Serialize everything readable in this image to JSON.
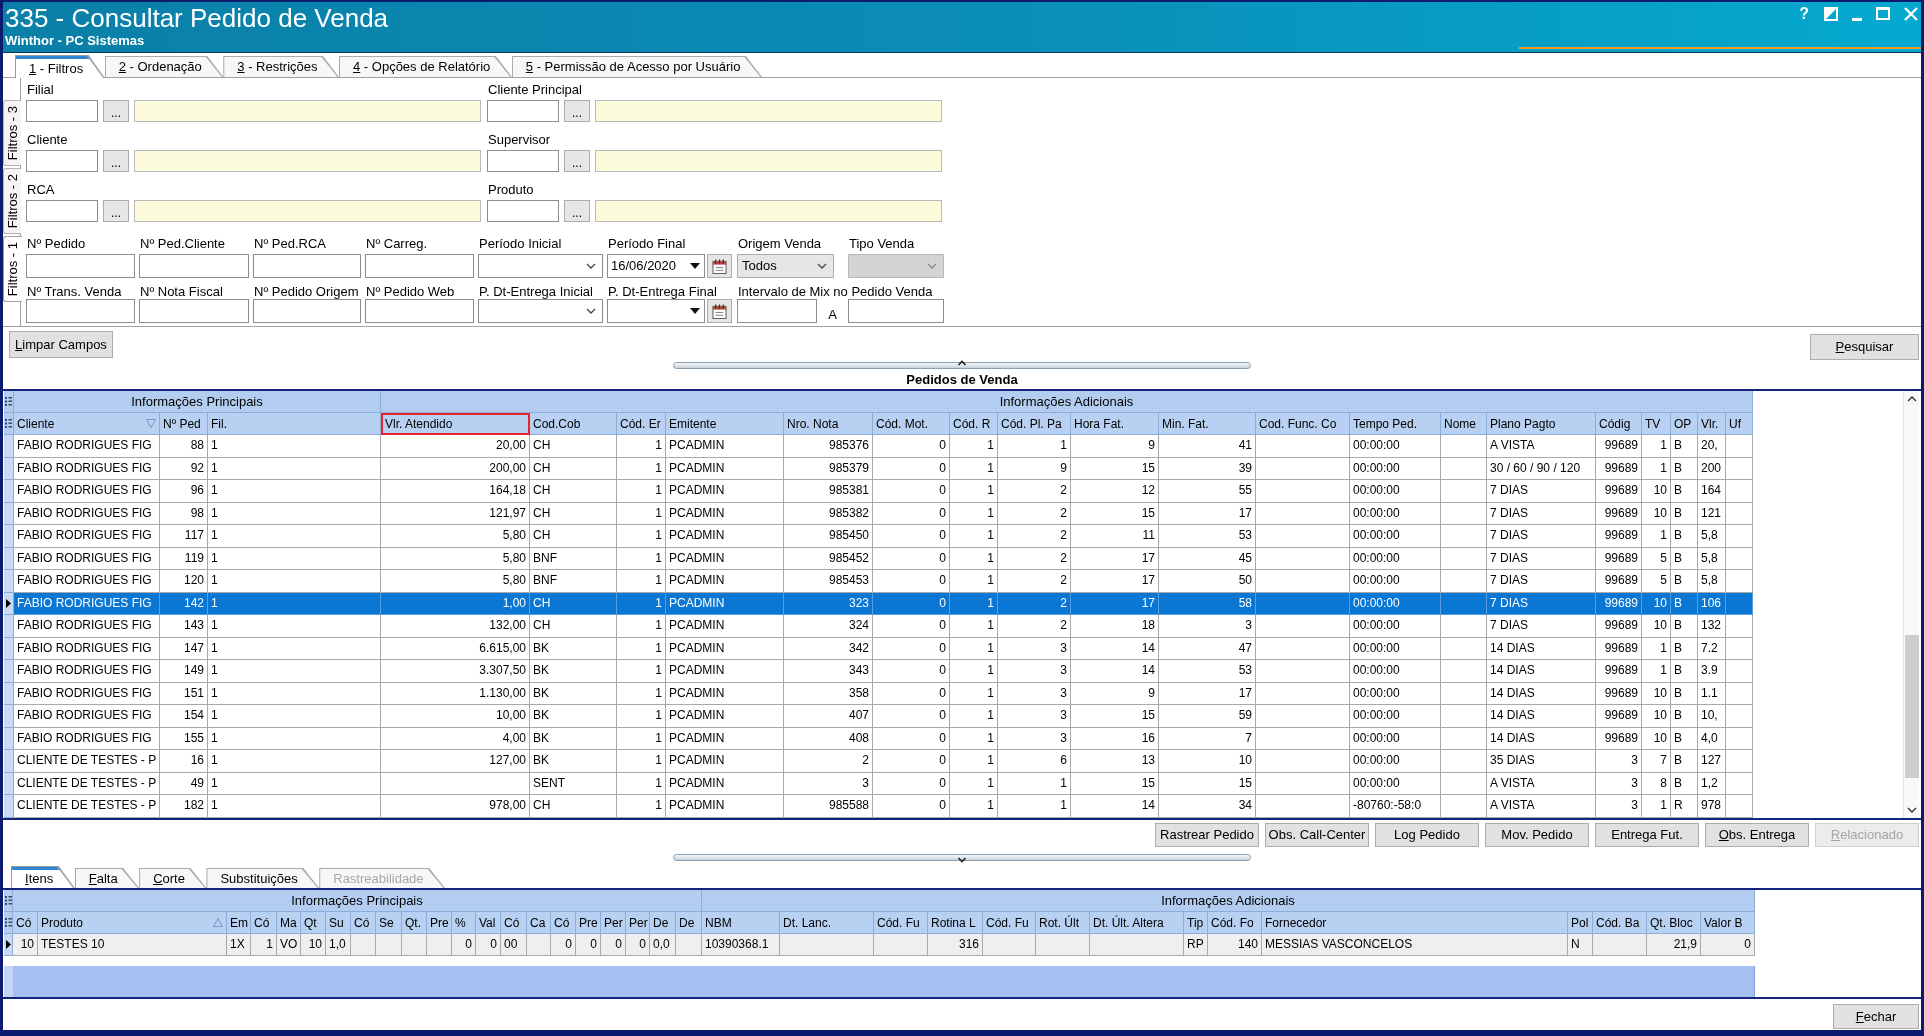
{
  "window": {
    "title": "335 - Consultar Pedido de Venda",
    "subtitle": "Winthor - PC Sistemas",
    "help": "?"
  },
  "tabs": [
    {
      "label": "1 - Filtros",
      "selected": true,
      "mnemonic": true
    },
    {
      "label": "2 - Ordenação",
      "selected": false,
      "mnemonic": true
    },
    {
      "label": "3 - Restrições",
      "selected": false,
      "mnemonic": true
    },
    {
      "label": "4 - Opções de Relatório",
      "selected": false,
      "mnemonic": true
    },
    {
      "label": "5 - Permissão de Acesso por Usuário",
      "selected": false,
      "mnemonic": true
    }
  ],
  "side_tabs": [
    {
      "label": "Filtros - 3",
      "selected": false
    },
    {
      "label": "Filtros - 2",
      "selected": false
    },
    {
      "label": "Filtros - 1",
      "selected": true
    }
  ],
  "lookups": [
    {
      "label": "Filial",
      "button": "..."
    },
    {
      "label": "Cliente Principal",
      "button": "..."
    },
    {
      "label": "Cliente",
      "button": "..."
    },
    {
      "label": "Supervisor",
      "button": "..."
    },
    {
      "label": "RCA",
      "button": "..."
    },
    {
      "label": "Produto",
      "button": "..."
    }
  ],
  "filter_rows": [
    {
      "fields": [
        {
          "label": "Nº Pedido",
          "kind": "text",
          "disabled": false
        },
        {
          "label": "Nº Ped.Cliente",
          "kind": "text",
          "disabled": false
        },
        {
          "label": "Nº Ped.RCA",
          "kind": "text",
          "disabled": false
        },
        {
          "label": "Nº Carreg.",
          "kind": "text",
          "disabled": false
        },
        {
          "label": "Período Inicial",
          "kind": "combo",
          "disabled": false
        },
        {
          "label": "Período Final",
          "kind": "date",
          "value": "16/06/2020",
          "disabled": false
        },
        {
          "label": "Origem Venda",
          "kind": "select",
          "value": "Todos",
          "disabled": false
        },
        {
          "label": "Tipo Venda",
          "kind": "select",
          "disabled": true
        }
      ]
    },
    {
      "fields": [
        {
          "label": "Nº Trans. Venda",
          "kind": "text",
          "disabled": false
        },
        {
          "label": "Nº Nota Fiscal",
          "kind": "text",
          "disabled": false
        },
        {
          "label": "Nº Pedido Origem",
          "kind": "text",
          "disabled": false
        },
        {
          "label": "Nº Pedido Web",
          "kind": "text",
          "disabled": false
        },
        {
          "label": "P. Dt-Entrega Inicial",
          "kind": "combo",
          "disabled": false
        },
        {
          "label": "P. Dt-Entrega Final",
          "kind": "date",
          "disabled": false
        },
        {
          "label": "Intervalo de Mix no Pedido Venda",
          "kind": "range",
          "separator": "A",
          "disabled": false
        }
      ]
    }
  ],
  "clear_button": {
    "label": "Limpar Campos",
    "mnemonic": true
  },
  "search_button": {
    "label": "Pesquisar",
    "mnemonic": true
  },
  "orders": {
    "title": "Pedidos de Venda",
    "groups": [
      {
        "label": "Informações Principais",
        "columns": [
          {
            "label": "Cliente",
            "kind": "text",
            "highlighted": false,
            "filter": true
          },
          {
            "label": "Nº Ped",
            "kind": "number",
            "highlighted": false,
            "filter": false
          },
          {
            "label": "Fil.",
            "kind": "text",
            "highlighted": false,
            "filter": false
          }
        ]
      },
      {
        "label": "Informações Adicionais",
        "columns": [
          {
            "label": "Vlr. Atendido",
            "kind": "number",
            "highlighted": true,
            "filter": false
          },
          {
            "label": "Cod.Cob",
            "kind": "text",
            "highlighted": false,
            "filter": false
          },
          {
            "label": "Cód. Er",
            "kind": "number",
            "highlighted": false,
            "filter": false
          },
          {
            "label": "Emitente",
            "kind": "text",
            "highlighted": false,
            "filter": false
          },
          {
            "label": "Nro. Nota",
            "kind": "number",
            "highlighted": false,
            "filter": false
          },
          {
            "label": "Cód. Mot.",
            "kind": "number",
            "highlighted": false,
            "filter": false
          },
          {
            "label": "Cód. R",
            "kind": "number",
            "highlighted": false,
            "filter": false
          },
          {
            "label": "Cód. Pl. Pa",
            "kind": "number",
            "highlighted": false,
            "filter": false
          },
          {
            "label": "Hora Fat.",
            "kind": "number",
            "highlighted": false,
            "filter": false
          },
          {
            "label": "Min. Fat.",
            "kind": "number",
            "highlighted": false,
            "filter": false
          },
          {
            "label": "Cod. Func. Co",
            "kind": "text",
            "highlighted": false,
            "filter": false
          },
          {
            "label": "Tempo Ped.",
            "kind": "text",
            "highlighted": false,
            "filter": false
          },
          {
            "label": "Nome",
            "kind": "text",
            "highlighted": false,
            "filter": false
          },
          {
            "label": "Plano Pagto",
            "kind": "text",
            "highlighted": false,
            "filter": false
          },
          {
            "label": "Códig",
            "kind": "number",
            "highlighted": false,
            "filter": false
          },
          {
            "label": "TV",
            "kind": "number",
            "highlighted": false,
            "filter": false
          },
          {
            "label": "OP",
            "kind": "text",
            "highlighted": false,
            "filter": false
          },
          {
            "label": "Vlr.",
            "kind": "text",
            "highlighted": false,
            "filter": false
          },
          {
            "label": "Uf",
            "kind": "text",
            "highlighted": false,
            "filter": false
          }
        ]
      }
    ],
    "rows": [
      {
        "selected": false,
        "cells": [
          "FABIO RODRIGUES FIG",
          "88",
          "1",
          "20,00",
          "CH",
          "1",
          "PCADMIN",
          "985376",
          "0",
          "1",
          "1",
          "9",
          "41",
          null,
          "00:00:00",
          null,
          "A VISTA",
          "99689",
          "1",
          "B",
          "20,",
          null
        ]
      },
      {
        "selected": false,
        "cells": [
          "FABIO RODRIGUES FIG",
          "92",
          "1",
          "200,00",
          "CH",
          "1",
          "PCADMIN",
          "985379",
          "0",
          "1",
          "9",
          "15",
          "39",
          null,
          "00:00:00",
          null,
          "30 / 60 / 90 / 120",
          "99689",
          "1",
          "B",
          "200",
          null
        ]
      },
      {
        "selected": false,
        "cells": [
          "FABIO RODRIGUES FIG",
          "96",
          "1",
          "164,18",
          "CH",
          "1",
          "PCADMIN",
          "985381",
          "0",
          "1",
          "2",
          "12",
          "55",
          null,
          "00:00:00",
          null,
          "7 DIAS",
          "99689",
          "10",
          "B",
          "164",
          null
        ]
      },
      {
        "selected": false,
        "cells": [
          "FABIO RODRIGUES FIG",
          "98",
          "1",
          "121,97",
          "CH",
          "1",
          "PCADMIN",
          "985382",
          "0",
          "1",
          "2",
          "15",
          "17",
          null,
          "00:00:00",
          null,
          "7 DIAS",
          "99689",
          "10",
          "B",
          "121",
          null
        ]
      },
      {
        "selected": false,
        "cells": [
          "FABIO RODRIGUES FIG",
          "117",
          "1",
          "5,80",
          "CH",
          "1",
          "PCADMIN",
          "985450",
          "0",
          "1",
          "2",
          "11",
          "53",
          null,
          "00:00:00",
          null,
          "7 DIAS",
          "99689",
          "1",
          "B",
          "5,8",
          null
        ]
      },
      {
        "selected": false,
        "cells": [
          "FABIO RODRIGUES FIG",
          "119",
          "1",
          "5,80",
          "BNF",
          "1",
          "PCADMIN",
          "985452",
          "0",
          "1",
          "2",
          "17",
          "45",
          null,
          "00:00:00",
          null,
          "7 DIAS",
          "99689",
          "5",
          "B",
          "5,8",
          null
        ]
      },
      {
        "selected": false,
        "cells": [
          "FABIO RODRIGUES FIG",
          "120",
          "1",
          "5,80",
          "BNF",
          "1",
          "PCADMIN",
          "985453",
          "0",
          "1",
          "2",
          "17",
          "50",
          null,
          "00:00:00",
          null,
          "7 DIAS",
          "99689",
          "5",
          "B",
          "5,8",
          null
        ]
      },
      {
        "selected": true,
        "cells": [
          "FABIO RODRIGUES FIG",
          "142",
          "1",
          "1,00",
          "CH",
          "1",
          "PCADMIN",
          "323",
          "0",
          "1",
          "2",
          "17",
          "58",
          null,
          "00:00:00",
          null,
          "7 DIAS",
          "99689",
          "10",
          "B",
          "106",
          null
        ]
      },
      {
        "selected": false,
        "cells": [
          "FABIO RODRIGUES FIG",
          "143",
          "1",
          "132,00",
          "CH",
          "1",
          "PCADMIN",
          "324",
          "0",
          "1",
          "2",
          "18",
          "3",
          null,
          "00:00:00",
          null,
          "7 DIAS",
          "99689",
          "10",
          "B",
          "132",
          null
        ]
      },
      {
        "selected": false,
        "cells": [
          "FABIO RODRIGUES FIG",
          "147",
          "1",
          "6.615,00",
          "BK",
          "1",
          "PCADMIN",
          "342",
          "0",
          "1",
          "3",
          "14",
          "47",
          null,
          "00:00:00",
          null,
          "14 DIAS",
          "99689",
          "1",
          "B",
          "7.2",
          null
        ]
      },
      {
        "selected": false,
        "cells": [
          "FABIO RODRIGUES FIG",
          "149",
          "1",
          "3.307,50",
          "BK",
          "1",
          "PCADMIN",
          "343",
          "0",
          "1",
          "3",
          "14",
          "53",
          null,
          "00:00:00",
          null,
          "14 DIAS",
          "99689",
          "1",
          "B",
          "3.9",
          null
        ]
      },
      {
        "selected": false,
        "cells": [
          "FABIO RODRIGUES FIG",
          "151",
          "1",
          "1.130,00",
          "BK",
          "1",
          "PCADMIN",
          "358",
          "0",
          "1",
          "3",
          "9",
          "17",
          null,
          "00:00:00",
          null,
          "14 DIAS",
          "99689",
          "10",
          "B",
          "1.1",
          null
        ]
      },
      {
        "selected": false,
        "cells": [
          "FABIO RODRIGUES FIG",
          "154",
          "1",
          "10,00",
          "BK",
          "1",
          "PCADMIN",
          "407",
          "0",
          "1",
          "3",
          "15",
          "59",
          null,
          "00:00:00",
          null,
          "14 DIAS",
          "99689",
          "10",
          "B",
          "10,",
          null
        ]
      },
      {
        "selected": false,
        "cells": [
          "FABIO RODRIGUES FIG",
          "155",
          "1",
          "4,00",
          "BK",
          "1",
          "PCADMIN",
          "408",
          "0",
          "1",
          "3",
          "16",
          "7",
          null,
          "00:00:00",
          null,
          "14 DIAS",
          "99689",
          "10",
          "B",
          "4,0",
          null
        ]
      },
      {
        "selected": false,
        "cells": [
          "CLIENTE DE TESTES - P",
          "16",
          "1",
          "127,00",
          "BK",
          "1",
          "PCADMIN",
          "2",
          "0",
          "1",
          "6",
          "13",
          "10",
          null,
          "00:00:00",
          null,
          "35 DIAS",
          "3",
          "7",
          "B",
          "127",
          null
        ]
      },
      {
        "selected": false,
        "cells": [
          "CLIENTE DE TESTES - P",
          "49",
          "1",
          null,
          "SENT",
          "1",
          "PCADMIN",
          "3",
          "0",
          "1",
          "1",
          "15",
          "15",
          null,
          "00:00:00",
          null,
          "A VISTA",
          "3",
          "8",
          "B",
          "1,2",
          null
        ]
      },
      {
        "selected": false,
        "cells": [
          "CLIENTE DE TESTES - P",
          "182",
          "1",
          "978,00",
          "CH",
          "1",
          "PCADMIN",
          "985588",
          "0",
          "1",
          "1",
          "14",
          "34",
          null,
          "-80760:-58:0",
          null,
          "A VISTA",
          "3",
          "1",
          "R",
          "978",
          null
        ]
      }
    ]
  },
  "order_buttons": [
    {
      "label": "Rastrear Pedido",
      "mnemonic": false,
      "disabled": false
    },
    {
      "label": "Obs. Call-Center",
      "mnemonic": false,
      "disabled": false
    },
    {
      "label": "Log Pedido",
      "mnemonic": false,
      "disabled": false
    },
    {
      "label": "Mov. Pedido",
      "mnemonic": false,
      "disabled": false
    },
    {
      "label": "Entrega Fut.",
      "mnemonic": false,
      "disabled": false
    },
    {
      "label": "Obs. Entrega",
      "mnemonic": true,
      "disabled": false
    },
    {
      "label": "Relacionado",
      "mnemonic": true,
      "disabled": true
    }
  ],
  "detail_tabs": [
    {
      "label": "Itens",
      "selected": true,
      "mnemonic": true,
      "disabled": false
    },
    {
      "label": "Falta",
      "selected": false,
      "mnemonic": true,
      "disabled": false
    },
    {
      "label": "Corte",
      "selected": false,
      "mnemonic": true,
      "disabled": false
    },
    {
      "label": "Substituições",
      "selected": false,
      "mnemonic": false,
      "disabled": false
    },
    {
      "label": "Rastreabilidade",
      "selected": false,
      "mnemonic": false,
      "disabled": true
    }
  ],
  "items": {
    "groups": [
      {
        "label": "Informações Principais",
        "columns": [
          {
            "label": "Có",
            "kind": "number",
            "sorted": false
          },
          {
            "label": "Produto",
            "kind": "text",
            "sorted": true
          },
          {
            "label": "Em",
            "kind": "text",
            "sorted": false
          },
          {
            "label": "Có",
            "kind": "number",
            "sorted": false
          },
          {
            "label": "Ma",
            "kind": "text",
            "sorted": false
          },
          {
            "label": "Qt",
            "kind": "number",
            "sorted": false
          },
          {
            "label": "Su",
            "kind": "text",
            "sorted": false
          },
          {
            "label": "Có",
            "kind": "text",
            "sorted": false
          },
          {
            "label": "Se",
            "kind": "text",
            "sorted": false
          },
          {
            "label": "Qt.",
            "kind": "text",
            "sorted": false
          },
          {
            "label": "Pre",
            "kind": "text",
            "sorted": false
          },
          {
            "label": "%",
            "kind": "number",
            "sorted": false
          },
          {
            "label": "Val",
            "kind": "number",
            "sorted": false
          },
          {
            "label": "Có",
            "kind": "text",
            "sorted": false
          },
          {
            "label": "Ca",
            "kind": "text",
            "sorted": false
          },
          {
            "label": "Có",
            "kind": "number",
            "sorted": false
          },
          {
            "label": "Pre",
            "kind": "number",
            "sorted": false
          },
          {
            "label": "Per",
            "kind": "number",
            "sorted": false
          },
          {
            "label": "Per",
            "kind": "number",
            "sorted": false
          },
          {
            "label": "De",
            "kind": "text",
            "sorted": false
          },
          {
            "label": "De",
            "kind": "text",
            "sorted": false
          }
        ]
      },
      {
        "label": "Informações Adicionais",
        "columns": [
          {
            "label": "NBM",
            "kind": "text",
            "sorted": false
          },
          {
            "label": "Dt. Lanc.",
            "kind": "text",
            "sorted": false
          },
          {
            "label": "Cód. Fu",
            "kind": "text",
            "sorted": false
          },
          {
            "label": "Rotina L",
            "kind": "number",
            "sorted": false
          },
          {
            "label": "Cód. Fu",
            "kind": "text",
            "sorted": false
          },
          {
            "label": "Rot. Últ",
            "kind": "text",
            "sorted": false
          },
          {
            "label": "Dt. Últ. Altera",
            "kind": "text",
            "sorted": false
          },
          {
            "label": "Tip",
            "kind": "text",
            "sorted": false
          },
          {
            "label": "Cód. Fo",
            "kind": "number",
            "sorted": false
          },
          {
            "label": "Fornecedor",
            "kind": "text",
            "sorted": false
          },
          {
            "label": "Pol",
            "kind": "text",
            "sorted": false
          },
          {
            "label": "Cód. Ba",
            "kind": "text",
            "sorted": false
          },
          {
            "label": "Qt. Bloc",
            "kind": "number",
            "sorted": false
          },
          {
            "label": "Valor B",
            "kind": "number",
            "sorted": false
          }
        ]
      }
    ],
    "rows": [
      {
        "selected": true,
        "cells": [
          "10",
          "TESTES 10",
          "1X",
          "1",
          "VO",
          "10",
          "1,0",
          null,
          null,
          null,
          null,
          "0",
          "0",
          "00",
          null,
          "0",
          "0",
          "0",
          "0",
          "0,0",
          null,
          "10390368.1",
          null,
          null,
          "316",
          null,
          null,
          null,
          "RP",
          "140",
          "MESSIAS VASCONCELOS",
          "N",
          null,
          "21,9",
          "0"
        ]
      }
    ]
  },
  "close_button": {
    "label": "Fechar",
    "mnemonic": true
  }
}
